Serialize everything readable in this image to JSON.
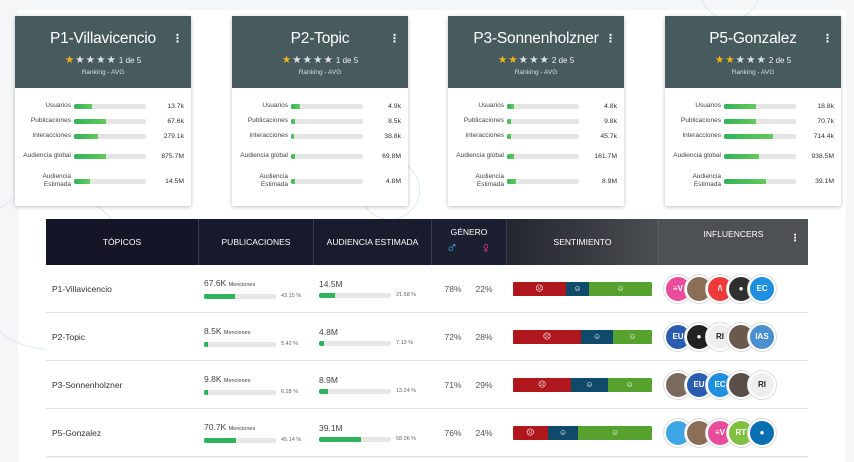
{
  "cards": [
    {
      "title": "P1-Villavicencio",
      "stars_on": 1,
      "stars_off": 4,
      "rating_text": "1 de 5",
      "ranking": "Ranking - AVG",
      "metrics": [
        {
          "label": "Usuarios",
          "value": "13.7k",
          "fill": 0.25
        },
        {
          "label": "Publicaciones",
          "value": "67.6k",
          "fill": 0.45
        },
        {
          "label": "Interacciones",
          "value": "279.1k",
          "fill": 0.33
        },
        {
          "label": "Audiencia global",
          "value": "875.7M",
          "fill": 0.45
        },
        {
          "label": "Audiencia Estimada",
          "value": "14.5M",
          "fill": 0.22
        }
      ]
    },
    {
      "title": "P2-Topic",
      "stars_on": 1,
      "stars_off": 4,
      "rating_text": "1 de 5",
      "ranking": "Ranking - AVG",
      "metrics": [
        {
          "label": "Usuarios",
          "value": "4.9k",
          "fill": 0.12
        },
        {
          "label": "Publicaciones",
          "value": "8.5k",
          "fill": 0.05
        },
        {
          "label": "Interacciones",
          "value": "38.8k",
          "fill": 0.04
        },
        {
          "label": "Audiencia global",
          "value": "69.8M",
          "fill": 0.05
        },
        {
          "label": "Audiencia Estimada",
          "value": "4.8M",
          "fill": 0.05
        }
      ]
    },
    {
      "title": "P3-Sonnenholzner",
      "stars_on": 2,
      "stars_off": 3,
      "rating_text": "2 de 5",
      "ranking": "Ranking - AVG",
      "metrics": [
        {
          "label": "Usuarios",
          "value": "4.8k",
          "fill": 0.1
        },
        {
          "label": "Publicaciones",
          "value": "9.8k",
          "fill": 0.06
        },
        {
          "label": "Interacciones",
          "value": "45.7k",
          "fill": 0.05
        },
        {
          "label": "Audiencia global",
          "value": "161.7M",
          "fill": 0.1
        },
        {
          "label": "Audiencia Estimada",
          "value": "8.9M",
          "fill": 0.12
        }
      ]
    },
    {
      "title": "P5-Gonzalez",
      "stars_on": 2,
      "stars_off": 3,
      "rating_text": "2 de 5",
      "ranking": "Ranking - AVG",
      "metrics": [
        {
          "label": "Usuarios",
          "value": "18.8k",
          "fill": 0.45
        },
        {
          "label": "Publicaciones",
          "value": "70.7k",
          "fill": 0.45
        },
        {
          "label": "Interacciones",
          "value": "714.4k",
          "fill": 0.68
        },
        {
          "label": "Audiencia global",
          "value": "938.5M",
          "fill": 0.48
        },
        {
          "label": "Audiencia Estimada",
          "value": "39.1M",
          "fill": 0.58
        }
      ]
    }
  ],
  "table": {
    "headers": {
      "topics": "TÓPICOS",
      "publications": "PUBLICACIONES",
      "audience": "AUDIENCIA ESTIMADA",
      "gender": "GÉNERO",
      "sentiment": "SENTIMIENTO",
      "influencers": "INFLUENCERS"
    },
    "rows": [
      {
        "topic": "P1-Villavicencio",
        "pub": "67.6K",
        "pub_unit": "Menciones",
        "pub_pct": "43.15 %",
        "pub_fill": 0.43,
        "aud": "14.5M",
        "aud_pct": "21.58 %",
        "aud_fill": 0.22,
        "male": "78%",
        "female": "22%",
        "sent": [
          0.38,
          0.17,
          0.45
        ],
        "influencers": [
          {
            "label": "≡V",
            "color": "#e84c9a"
          },
          {
            "label": "",
            "color": "#8a6e55"
          },
          {
            "label": "/\\",
            "color": "#ee3a3a"
          },
          {
            "label": "●",
            "color": "#2f2f2f"
          },
          {
            "label": "EC",
            "color": "#1f8fe0"
          }
        ]
      },
      {
        "topic": "P2-Topic",
        "pub": "8.5K",
        "pub_unit": "Menciones",
        "pub_pct": "5.42 %",
        "pub_fill": 0.05,
        "aud": "4.8M",
        "aud_pct": "7.13 %",
        "aud_fill": 0.07,
        "male": "72%",
        "female": "28%",
        "sent": [
          0.49,
          0.23,
          0.28
        ],
        "influencers": [
          {
            "label": "EU",
            "color": "#2a5db0"
          },
          {
            "label": "●",
            "color": "#222"
          },
          {
            "label": "RI",
            "color": "#eeeeee"
          },
          {
            "label": "",
            "color": "#6a5a4e"
          },
          {
            "label": "IAS",
            "color": "#4a8fd0"
          }
        ]
      },
      {
        "topic": "P3-Sonnenholzner",
        "pub": "9.8K",
        "pub_unit": "Menciones",
        "pub_pct": "6.28 %",
        "pub_fill": 0.06,
        "aud": "8.9M",
        "aud_pct": "13.24 %",
        "aud_fill": 0.13,
        "male": "71%",
        "female": "29%",
        "sent": [
          0.42,
          0.26,
          0.32
        ],
        "influencers": [
          {
            "label": "",
            "color": "#7a6a5e"
          },
          {
            "label": "EU",
            "color": "#2a5db0"
          },
          {
            "label": "EC",
            "color": "#1f8fe0"
          },
          {
            "label": "",
            "color": "#5a4e48"
          },
          {
            "label": "RI",
            "color": "#eeeeee"
          }
        ]
      },
      {
        "topic": "P5-Gonzalez",
        "pub": "70.7K",
        "pub_unit": "Menciones",
        "pub_pct": "45.14 %",
        "pub_fill": 0.45,
        "aud": "39.1M",
        "aud_pct": "58.06 %",
        "aud_fill": 0.58,
        "male": "76%",
        "female": "24%",
        "sent": [
          0.25,
          0.22,
          0.53
        ],
        "influencers": [
          {
            "label": "",
            "color": "#3fa6e6"
          },
          {
            "label": "",
            "color": "#8a6e55"
          },
          {
            "label": "≡V",
            "color": "#e84c9a"
          },
          {
            "label": "RT",
            "color": "#7fc041"
          },
          {
            "label": "●",
            "color": "#0a6fb0"
          }
        ]
      }
    ]
  },
  "icons": {
    "star": "star-icon",
    "kebab": "kebab-menu-icon",
    "male": "male-icon",
    "female": "female-icon",
    "sad": "sad-face-icon",
    "neutral": "neutral-face-icon",
    "happy": "happy-face-icon"
  }
}
